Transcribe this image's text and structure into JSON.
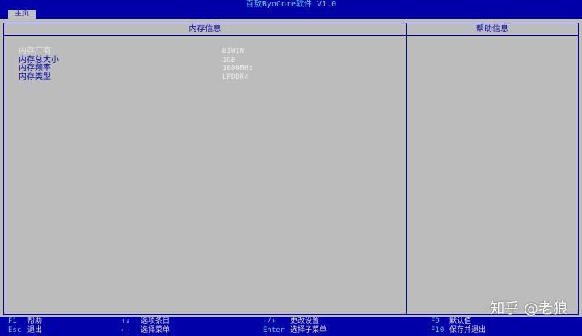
{
  "window": {
    "title": "百敖ByoCore软件 V1.0"
  },
  "tabs": [
    {
      "label": "主页"
    }
  ],
  "left_panel": {
    "title": "内存信息",
    "rows": [
      {
        "label": "内存厂商",
        "value": "BIWIN"
      },
      {
        "label": "内存总大小",
        "value": "1GB"
      },
      {
        "label": "内存频率",
        "value": "1600MHz"
      },
      {
        "label": "内存类型",
        "value": "LPDDR4"
      }
    ]
  },
  "right_panel": {
    "title": "帮助信息"
  },
  "footer": {
    "hints": [
      {
        "key": "F1",
        "desc": "帮助"
      },
      {
        "key": "Esc",
        "desc": "退出"
      },
      {
        "key": "↑↓",
        "desc": "选项条目"
      },
      {
        "key": "←→",
        "desc": "选择菜单"
      },
      {
        "key": "-/+",
        "desc": "更改设置"
      },
      {
        "key": "Enter",
        "desc": "选择子菜单"
      },
      {
        "key": "F9",
        "desc": "默认值"
      },
      {
        "key": "F10",
        "desc": "保存并退出"
      }
    ]
  },
  "watermark": "知乎 @老狼",
  "colors": {
    "background": "#0000a8",
    "panel": "#bcbcbc",
    "highlight": "#5fd7ff",
    "text_light": "#f0f0f0"
  }
}
